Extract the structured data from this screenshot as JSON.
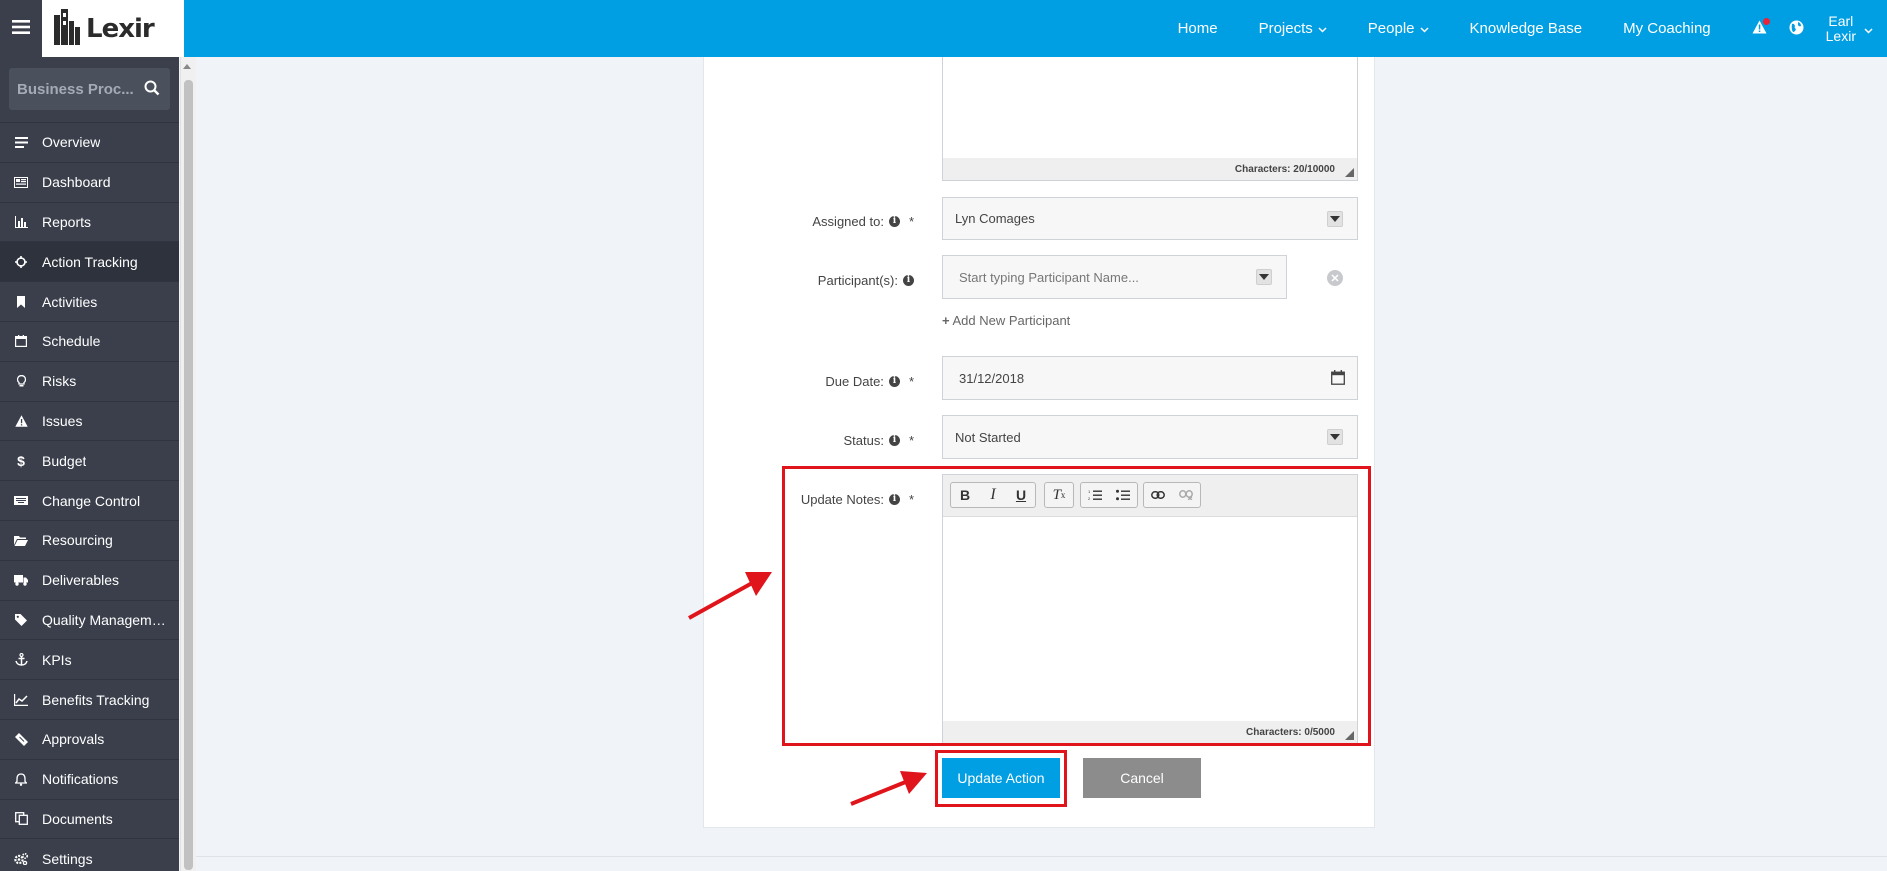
{
  "app": {
    "logo_text": "Lexir"
  },
  "nav": {
    "items": [
      {
        "label": "Home",
        "dropdown": false
      },
      {
        "label": "Projects",
        "dropdown": true
      },
      {
        "label": "People",
        "dropdown": true
      },
      {
        "label": "Knowledge Base",
        "dropdown": false
      },
      {
        "label": "My Coaching",
        "dropdown": false
      }
    ],
    "user_first": "Earl",
    "user_last": "Lexir"
  },
  "sidebar": {
    "search_placeholder": "Business Proc...",
    "items": [
      {
        "label": "Overview",
        "icon": "list-icon"
      },
      {
        "label": "Dashboard",
        "icon": "dashboard-icon"
      },
      {
        "label": "Reports",
        "icon": "bar-chart-icon"
      },
      {
        "label": "Action Tracking",
        "icon": "crosshair-icon",
        "active": true
      },
      {
        "label": "Activities",
        "icon": "bookmark-icon"
      },
      {
        "label": "Schedule",
        "icon": "calendar-icon"
      },
      {
        "label": "Risks",
        "icon": "lightbulb-icon"
      },
      {
        "label": "Issues",
        "icon": "warning-icon"
      },
      {
        "label": "Budget",
        "icon": "dollar-icon"
      },
      {
        "label": "Change Control",
        "icon": "keyboard-icon"
      },
      {
        "label": "Resourcing",
        "icon": "folder-open-icon"
      },
      {
        "label": "Deliverables",
        "icon": "truck-icon"
      },
      {
        "label": "Quality Manageme...",
        "icon": "tag-icon"
      },
      {
        "label": "KPIs",
        "icon": "anchor-icon"
      },
      {
        "label": "Benefits Tracking",
        "icon": "line-chart-icon"
      },
      {
        "label": "Approvals",
        "icon": "ticket-icon"
      },
      {
        "label": "Notifications",
        "icon": "bell-icon"
      },
      {
        "label": "Documents",
        "icon": "copy-icon"
      },
      {
        "label": "Settings",
        "icon": "cogs-icon"
      }
    ]
  },
  "form": {
    "description_chars": "Characters: 20/10000",
    "assigned_label": "Assigned to:",
    "assigned_value": "Lyn Comages",
    "participants_label": "Participant(s):",
    "participants_placeholder": "Start typing Participant Name...",
    "add_participant": "Add New Participant",
    "due_label": "Due Date:",
    "due_value": "31/12/2018",
    "status_label": "Status:",
    "status_value": "Not Started",
    "notes_label": "Update Notes:",
    "notes_chars": "Characters: 0/5000",
    "required_mark": "*",
    "info_glyph": "i"
  },
  "actions": {
    "update_label": "Update Action",
    "cancel_label": "Cancel"
  },
  "colors": {
    "brand_blue": "#009fe3",
    "sidebar_bg": "#3a3f4b",
    "highlight_red": "#e0141b",
    "cancel_gray": "#8c8c8c"
  }
}
